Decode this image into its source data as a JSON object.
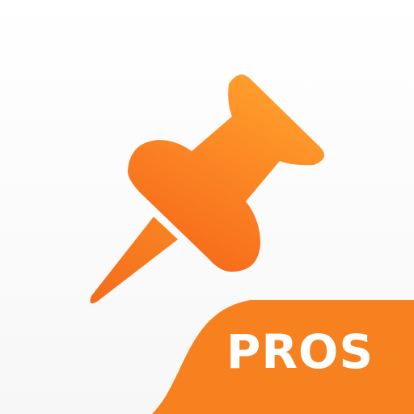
{
  "app_icon": {
    "badge_text": "PROS",
    "icon": "pushpin-icon",
    "colors": {
      "background": "#ffffff",
      "accent": "#f7801f",
      "pin_light": "#ff9b2a",
      "pin_dark": "#f66a18",
      "badge_text": "#ffffff"
    }
  }
}
